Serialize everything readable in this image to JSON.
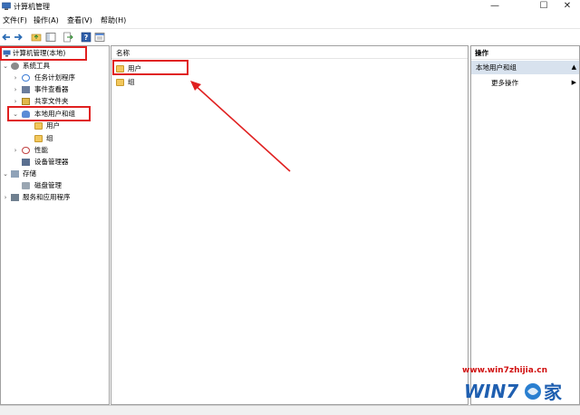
{
  "window": {
    "title": "计算机管理",
    "controls": {
      "minimize": "—",
      "maximize": "☐",
      "close": "✕"
    }
  },
  "menu": [
    "文件(F)",
    "操作(A)",
    "查看(V)",
    "帮助(H)"
  ],
  "toolbar": [
    "back-icon",
    "forward-icon",
    "up-folder-icon",
    "show-hide-tree-icon",
    "export-icon",
    "help-icon",
    "properties-icon"
  ],
  "tree": {
    "root": "计算机管理(本地)",
    "items": [
      {
        "label": "系统工具",
        "expanded": true
      },
      {
        "label": "任务计划程序",
        "expanded": false
      },
      {
        "label": "事件查看器",
        "expanded": false
      },
      {
        "label": "共享文件夹",
        "expanded": false
      },
      {
        "label": "本地用户和组",
        "expanded": true
      },
      {
        "label": "用户"
      },
      {
        "label": "组"
      },
      {
        "label": "性能",
        "expanded": false
      },
      {
        "label": "设备管理器"
      },
      {
        "label": "存储",
        "expanded": true
      },
      {
        "label": "磁盘管理"
      },
      {
        "label": "服务和应用程序",
        "expanded": false
      }
    ]
  },
  "list": {
    "column_name": "名称",
    "rows": [
      "用户",
      "组"
    ]
  },
  "actions": {
    "header": "操作",
    "section": "本地用户和组",
    "more": "更多操作"
  },
  "watermark": {
    "url": "www.win7zhijia.cn",
    "logo_text": "WIN7",
    "logo_suffix": "家"
  },
  "colors": {
    "annotation": "#e02020",
    "selection": "#d8e2ee"
  }
}
